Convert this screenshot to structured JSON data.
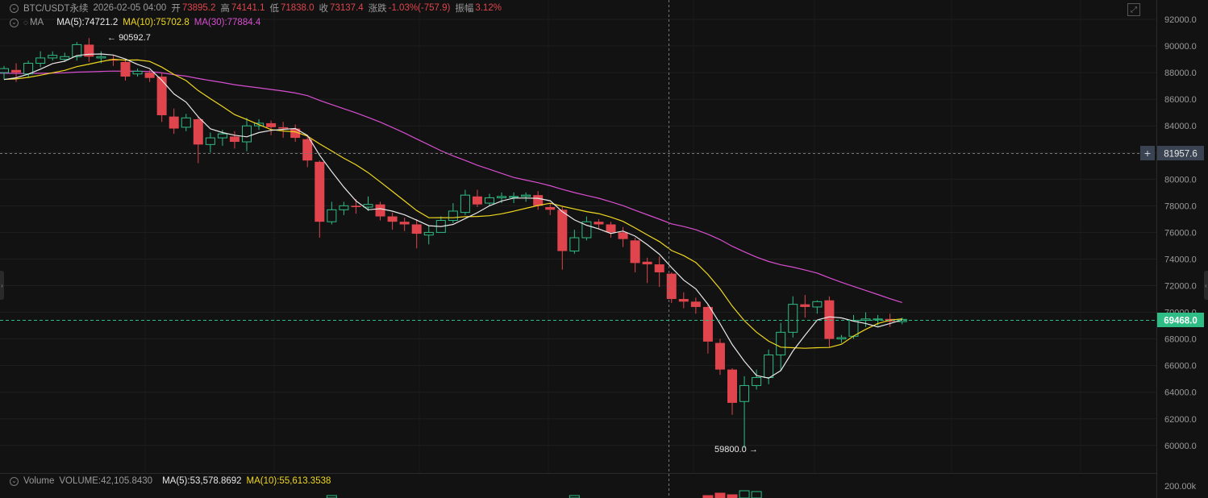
{
  "header": {
    "symbol": "BTC/USDT永续",
    "time": "2026-02-05 04:00",
    "open_label": "开",
    "open": "73895.2",
    "high_label": "高",
    "high": "74141.1",
    "low_label": "低",
    "low": "71838.0",
    "close_label": "收",
    "close": "73137.4",
    "change_label": "涨跌",
    "change": "-1.03%(-757.9)",
    "amp_label": "振幅",
    "amp": "3.12%"
  },
  "ma": {
    "label": "MA",
    "ma5": "MA(5):74721.2",
    "ma10": "MA(10):75702.8",
    "ma30": "MA(30):77884.4"
  },
  "volume": {
    "label": "Volume",
    "value": "VOLUME:42,105.8430",
    "ma5": "MA(5):53,578.8692",
    "ma10": "MA(10):55,613.3538",
    "axis_label": "200.00k"
  },
  "annotations": {
    "high": "90592.7",
    "low": "59800.0"
  },
  "price_tags": {
    "crosshair": "81957.6",
    "last": "69468.0"
  },
  "colors": {
    "up": "#2ebd85",
    "down": "#e0454d",
    "ma5": "#e8e8e8",
    "ma10": "#f0d81e",
    "ma30": "#d84ed0",
    "background": "#121212"
  },
  "icons": {
    "expand": "expand-icon",
    "collapse": "collapse-icon",
    "eye": "eye-icon",
    "crosshair_add": "plus-icon"
  },
  "chart_data": {
    "type": "candlestick",
    "title": "",
    "y_ticks": [
      "92000.0",
      "90000.0",
      "88000.0",
      "86000.0",
      "84000.0",
      "82000.0",
      "80000.0",
      "78000.0",
      "76000.0",
      "74000.0",
      "72000.0",
      "70000.0",
      "68000.0",
      "66000.0",
      "64000.0",
      "62000.0",
      "60000.0"
    ],
    "ylim": [
      58500,
      93200
    ],
    "candles": [
      [
        88000,
        88300,
        87500,
        88500
      ],
      [
        88200,
        88000,
        87300,
        88700
      ],
      [
        87900,
        88700,
        87600,
        88900
      ],
      [
        88700,
        89100,
        88400,
        89600
      ],
      [
        89100,
        89300,
        88900,
        89600
      ],
      [
        89000,
        89200,
        88800,
        89500
      ],
      [
        89200,
        90100,
        88900,
        90300
      ],
      [
        90100,
        89200,
        88800,
        90592.7
      ],
      [
        89100,
        89200,
        88700,
        89600
      ],
      [
        89000,
        88900,
        88500,
        89300
      ],
      [
        88800,
        87700,
        87400,
        89000
      ],
      [
        87900,
        88100,
        87700,
        88300
      ],
      [
        88000,
        87600,
        87300,
        88200
      ],
      [
        87700,
        84800,
        84300,
        88000
      ],
      [
        84700,
        83800,
        83400,
        85300
      ],
      [
        83900,
        84600,
        83600,
        84900
      ],
      [
        84500,
        82600,
        81200,
        84700
      ],
      [
        82600,
        83100,
        82000,
        83500
      ],
      [
        83100,
        83400,
        82500,
        83700
      ],
      [
        83200,
        82800,
        82300,
        83600
      ],
      [
        82800,
        84000,
        82100,
        84600
      ],
      [
        84000,
        84200,
        83700,
        84500
      ],
      [
        84200,
        83900,
        83300,
        84400
      ],
      [
        83900,
        83800,
        83100,
        84300
      ],
      [
        83800,
        83100,
        82800,
        84100
      ],
      [
        83000,
        81400,
        80900,
        83200
      ],
      [
        81300,
        76800,
        75600,
        81400
      ],
      [
        76800,
        77700,
        76600,
        78300
      ],
      [
        77700,
        78000,
        77300,
        78300
      ],
      [
        78000,
        77900,
        77400,
        78500
      ],
      [
        77900,
        78100,
        77600,
        78700
      ],
      [
        78100,
        77200,
        76900,
        78300
      ],
      [
        77200,
        76800,
        76200,
        77500
      ],
      [
        76800,
        76600,
        76100,
        77100
      ],
      [
        76600,
        75900,
        74800,
        77000
      ],
      [
        75800,
        76000,
        75100,
        76500
      ],
      [
        76000,
        76900,
        76300,
        77200
      ],
      [
        76900,
        77600,
        76700,
        78200
      ],
      [
        77500,
        78800,
        77300,
        79200
      ],
      [
        78700,
        78100,
        77900,
        79200
      ],
      [
        78200,
        78600,
        78000,
        78900
      ],
      [
        78600,
        78700,
        78200,
        79000
      ],
      [
        78700,
        78700,
        78200,
        79000
      ],
      [
        78700,
        78800,
        78300,
        79000
      ],
      [
        78800,
        78000,
        77700,
        79100
      ],
      [
        77900,
        77700,
        77300,
        78200
      ],
      [
        77700,
        74600,
        73200,
        77900
      ],
      [
        74600,
        75600,
        74400,
        76200
      ],
      [
        75600,
        76800,
        75400,
        77200
      ],
      [
        76800,
        76600,
        76300,
        77000
      ],
      [
        76600,
        76000,
        75600,
        76800
      ],
      [
        76000,
        75500,
        74900,
        76400
      ],
      [
        75400,
        73700,
        73000,
        75600
      ],
      [
        73800,
        73600,
        72200,
        74100
      ],
      [
        73600,
        73000,
        71900,
        74200
      ],
      [
        72900,
        71000,
        70700,
        73000
      ],
      [
        71000,
        70800,
        70300,
        71500
      ],
      [
        70800,
        70400,
        69900,
        71100
      ],
      [
        70400,
        67800,
        66900,
        70600
      ],
      [
        67700,
        65700,
        65300,
        68000
      ],
      [
        65700,
        63200,
        62300,
        65800
      ],
      [
        63300,
        64500,
        59800,
        65200
      ],
      [
        64500,
        65100,
        64200,
        65700
      ],
      [
        65100,
        66800,
        64600,
        67200
      ],
      [
        66800,
        68500,
        65600,
        69200
      ],
      [
        68500,
        70600,
        68100,
        71200
      ],
      [
        70600,
        70400,
        69600,
        71300
      ],
      [
        70400,
        70800,
        69900,
        70900
      ],
      [
        70900,
        68000,
        67400,
        71200
      ],
      [
        68000,
        68100,
        67700,
        68300
      ],
      [
        68200,
        69400,
        68000,
        69800
      ],
      [
        69400,
        69500,
        68900,
        70000
      ],
      [
        69500,
        69500,
        69000,
        69800
      ],
      [
        69500,
        69300,
        68900,
        69900
      ],
      [
        69300,
        69468,
        69100,
        69600
      ]
    ]
  }
}
